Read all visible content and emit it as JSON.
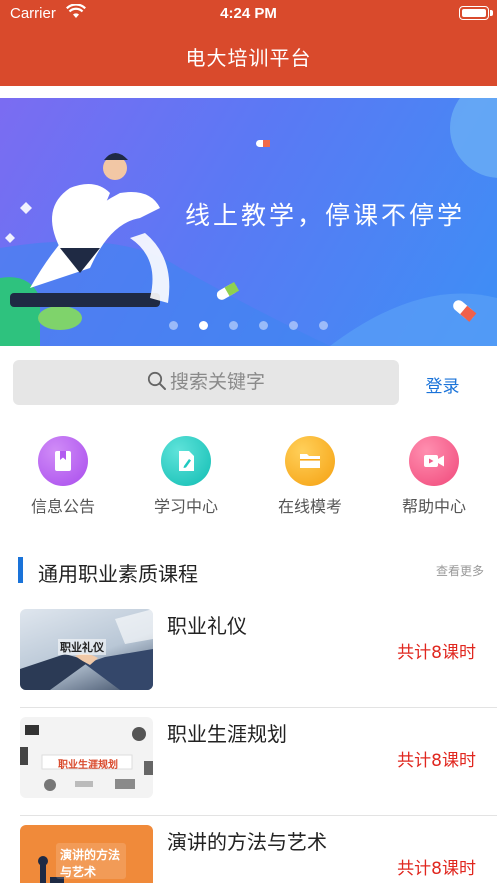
{
  "status_bar": {
    "carrier": "Carrier",
    "time": "4:24 PM"
  },
  "nav": {
    "title": "电大培训平台"
  },
  "banner": {
    "text": "线上教学，停课不停学",
    "slide_count": 6,
    "active_slide": 2
  },
  "search": {
    "placeholder": "搜索关键字",
    "login_label": "登录"
  },
  "quick_nav": [
    {
      "label": "信息公告",
      "icon": "bookmark-book-icon",
      "color": "#b25cf0"
    },
    {
      "label": "学习中心",
      "icon": "document-pen-icon",
      "color": "#1ec9c0"
    },
    {
      "label": "在线模考",
      "icon": "folder-icon",
      "color": "#f7a81b"
    },
    {
      "label": "帮助中心",
      "icon": "video-camera-icon",
      "color": "#f25d8b"
    }
  ],
  "section": {
    "title": "通用职业素质课程",
    "more": "查看更多"
  },
  "courses": [
    {
      "title": "职业礼仪",
      "hours": "共计8课时",
      "thumb_text": "职业礼仪"
    },
    {
      "title": "职业生涯规划",
      "hours": "共计8课时",
      "thumb_text": "职业生涯规划"
    },
    {
      "title": "演讲的方法与艺术",
      "hours": "共计8课时",
      "thumb_text": "演讲的方法与艺术"
    }
  ],
  "colors": {
    "nav_bg": "#d94a2c",
    "accent": "#1a73d9",
    "hours": "#e0271f"
  }
}
